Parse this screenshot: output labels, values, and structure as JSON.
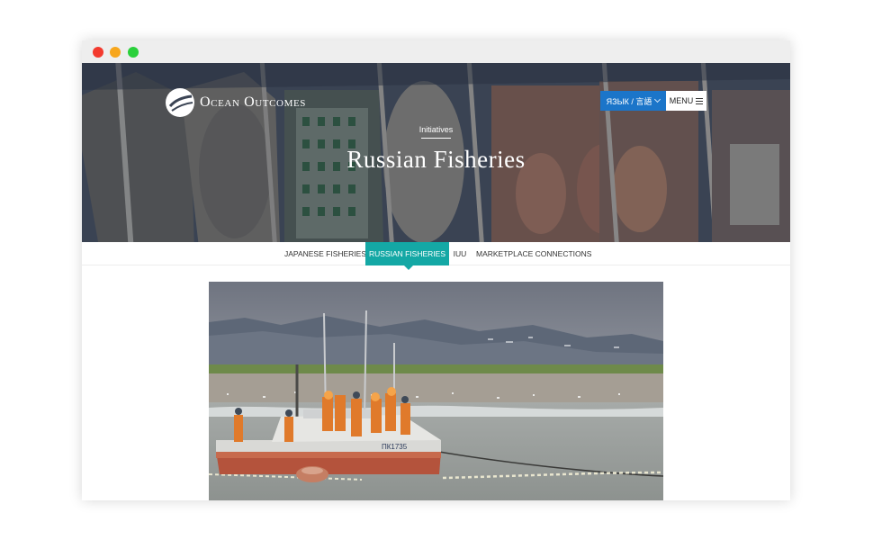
{
  "site": {
    "logo_text": "Ocean Outcomes",
    "language_button": "ЯЗЫК / 言語",
    "menu_button": "MENU"
  },
  "hero": {
    "eyebrow": "Initiatives",
    "title": "Russian Fisheries"
  },
  "subnav": {
    "items": [
      {
        "label": "JAPANESE FISHERIES",
        "active": false
      },
      {
        "label": "RUSSIAN FISHERIES",
        "active": true
      },
      {
        "label": "IUU",
        "active": false
      },
      {
        "label": "MARKETPLACE CONNECTIONS",
        "active": false
      }
    ]
  },
  "photo": {
    "boat_label": "ПК1735"
  },
  "colors": {
    "accent_teal": "#14a8a5",
    "language_blue": "#1b75c9",
    "traffic_red": "#f33a2e",
    "traffic_yellow": "#f7a61c",
    "traffic_green": "#2ad03b"
  },
  "icons": {
    "logo": "ocean-outcomes-logo-icon",
    "language_dropdown": "chevron-down-icon",
    "menu": "hamburger-icon"
  }
}
